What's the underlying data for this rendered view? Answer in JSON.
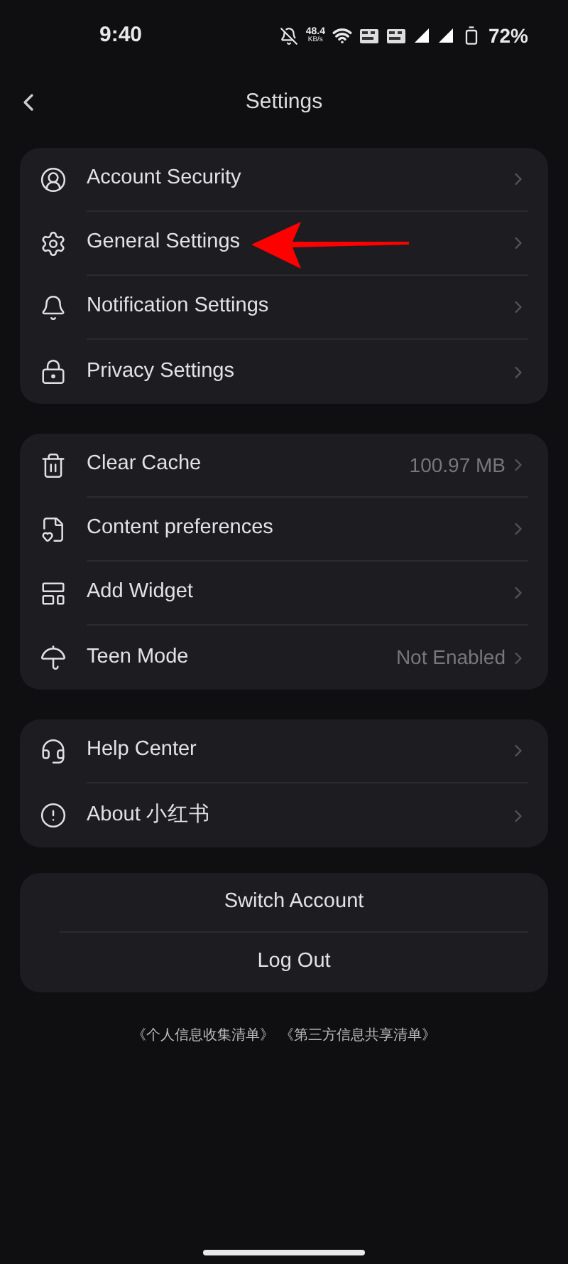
{
  "status_bar": {
    "time": "9:40",
    "speed": "48.4",
    "speed_unit": "KB/s",
    "battery": "72%"
  },
  "header": {
    "title": "Settings"
  },
  "groups": [
    {
      "items": [
        {
          "label": "Account Security"
        },
        {
          "label": "General Settings"
        },
        {
          "label": "Notification Settings"
        },
        {
          "label": "Privacy Settings"
        }
      ]
    },
    {
      "items": [
        {
          "label": "Clear Cache",
          "value": "100.97 MB"
        },
        {
          "label": "Content preferences"
        },
        {
          "label": "Add Widget"
        },
        {
          "label": "Teen Mode",
          "value": "Not Enabled"
        }
      ]
    },
    {
      "items": [
        {
          "label": "Help Center"
        },
        {
          "label": "About 小红书"
        }
      ]
    }
  ],
  "actions": [
    "Switch Account",
    "Log Out"
  ],
  "footer_links": [
    "《个人信息收集清单》",
    "《第三方信息共享清单》"
  ]
}
